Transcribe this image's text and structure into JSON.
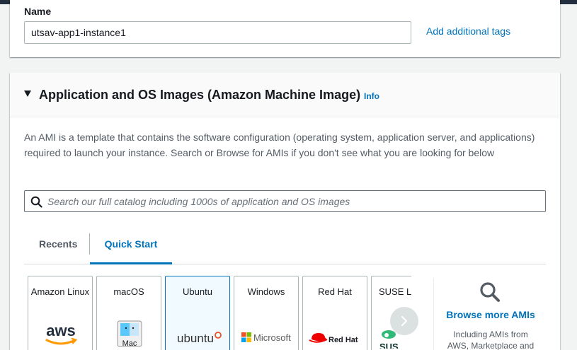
{
  "name_section": {
    "label": "Name",
    "input_value": "utsav-app1-instance1",
    "add_tags_link": "Add additional tags"
  },
  "ami_section": {
    "title": "Application and OS Images (Amazon Machine Image)",
    "info_link": "Info",
    "description": "An AMI is a template that contains the software configuration (operating system, application server, and applications) required to launch your instance. Search or Browse for AMIs if you don't see what you are looking for below",
    "search_placeholder": "Search our full catalog including 1000s of application and OS images",
    "tabs": [
      {
        "label": "Recents",
        "selected": false
      },
      {
        "label": "Quick Start",
        "selected": true
      }
    ],
    "os_cards": [
      {
        "name": "Amazon Linux",
        "logo": "aws-logo",
        "logo_text": "aws",
        "selected": false
      },
      {
        "name": "macOS",
        "logo": "mac-finder-logo",
        "logo_text": "Mac",
        "selected": false
      },
      {
        "name": "Ubuntu",
        "logo": "ubuntu-logo",
        "logo_text": "ubuntu",
        "selected": true
      },
      {
        "name": "Windows",
        "logo": "microsoft-logo",
        "logo_text": "Microsoft",
        "selected": false
      },
      {
        "name": "Red Hat",
        "logo": "redhat-logo",
        "logo_text": "Red Hat",
        "selected": false
      },
      {
        "name": "SUSE Li",
        "logo": "suse-logo",
        "logo_text": "SUS",
        "selected": false
      }
    ],
    "browse": {
      "link": "Browse more AMIs",
      "sub_line1": "Including AMIs from",
      "sub_line2": "AWS, Marketplace and"
    }
  },
  "colors": {
    "link": "#0073bb",
    "selected_card_bg": "#f1faff",
    "text_secondary": "#545b64",
    "top_nav": "#232f3e"
  }
}
